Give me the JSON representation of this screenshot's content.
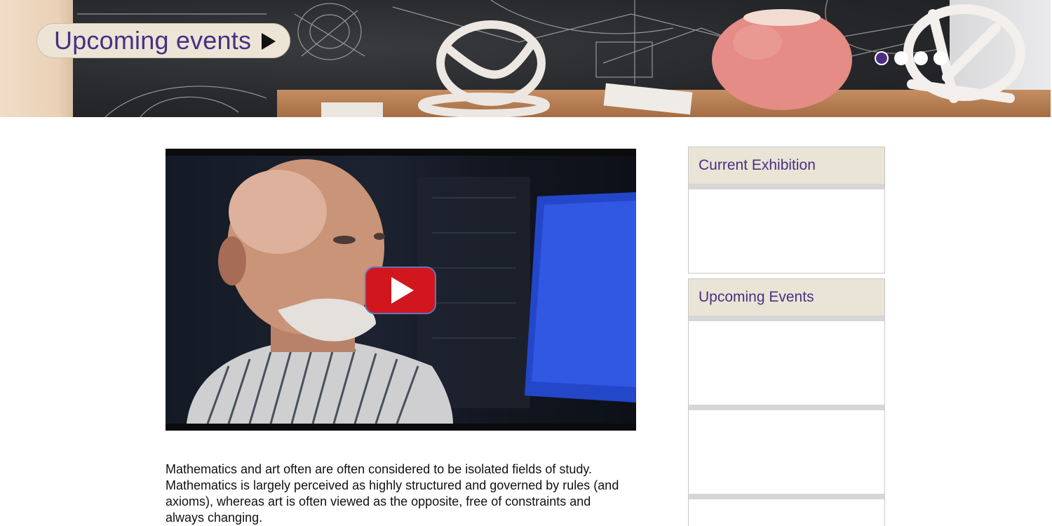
{
  "hero": {
    "pill_label": "Upcoming events",
    "arrow_icon": "play-arrow-icon",
    "slides": [
      {
        "name": "slide-1",
        "active": true
      },
      {
        "name": "slide-2",
        "active": false
      },
      {
        "name": "slide-3",
        "active": false
      },
      {
        "name": "slide-4",
        "active": false
      }
    ]
  },
  "video": {
    "play_icon": "youtube-play-icon"
  },
  "main": {
    "intro_text": "Mathematics and art often are often considered to be isolated fields of study. Mathematics is largely perceived as highly structured and governed by rules (and axioms), whereas art is often viewed as the opposite, free of constraints and always changing."
  },
  "sidebar": {
    "current_exhibition_title": "Current Exhibition",
    "upcoming_events_title": "Upcoming Events"
  },
  "colors": {
    "accent": "#4b2e83",
    "header_bg": "#e9e4d6",
    "play_red": "#d2161e"
  }
}
